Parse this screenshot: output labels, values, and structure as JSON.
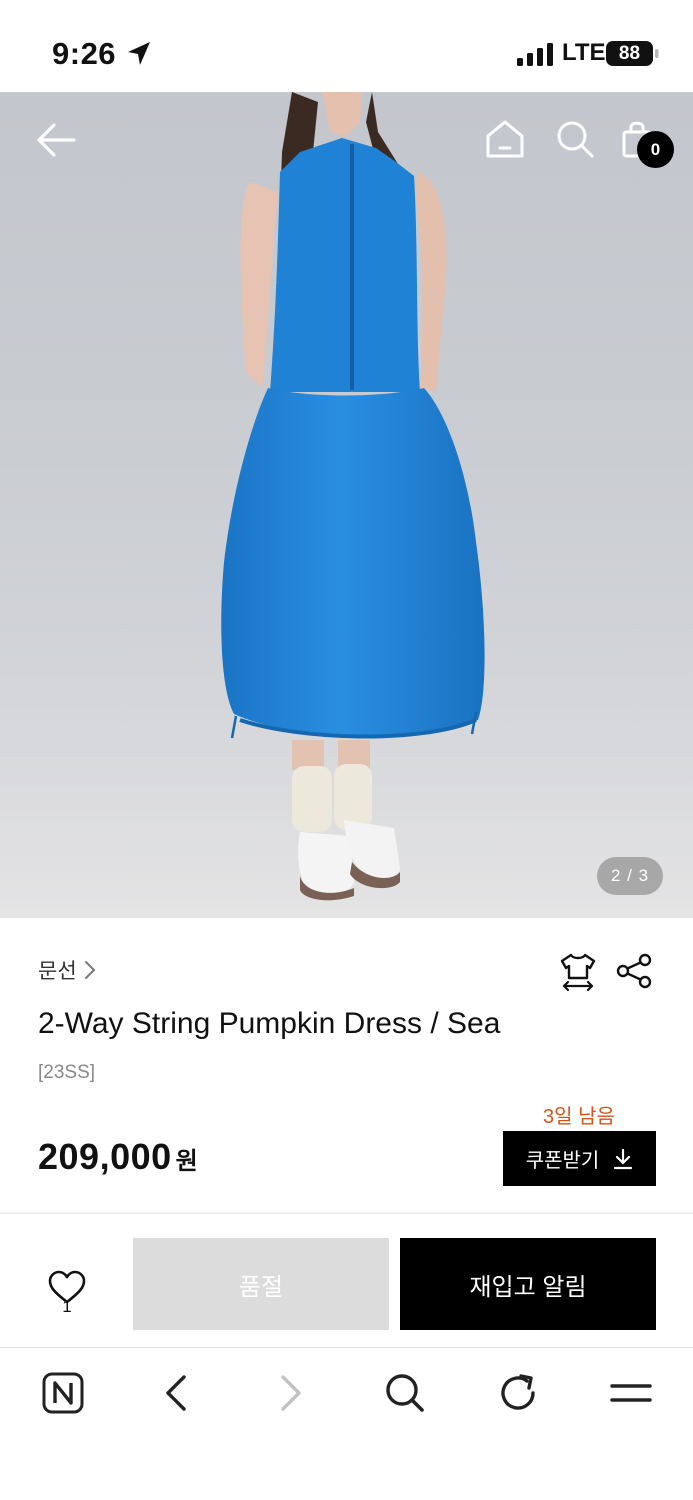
{
  "status_bar": {
    "time": "9:26",
    "network": "LTE",
    "battery": "88"
  },
  "header_icons": [
    "back-arrow-icon",
    "home-icon",
    "search-icon",
    "shopping-bag-icon"
  ],
  "cart": {
    "count": "0"
  },
  "gallery": {
    "indicator": "2 / 3"
  },
  "product": {
    "brand": "문선",
    "name": "2-Way String Pumpkin Dress / Sea",
    "season": "[23SS]",
    "price": "209,000",
    "currency": "원"
  },
  "coupon": {
    "days_left": "3일 남음",
    "label": "쿠폰받기"
  },
  "like": {
    "count": "1"
  },
  "actions": {
    "soldout": "품절",
    "restock": "재입고 알림"
  },
  "toolbar": [
    "naver-n-icon",
    "back-icon",
    "forward-icon",
    "search-icon",
    "refresh-icon",
    "menu-icon"
  ],
  "colors": {
    "accent": "#d2551f",
    "dress": "#1f86d8",
    "primary_button": "#000000",
    "disabled_button": "#dcdcdc"
  }
}
